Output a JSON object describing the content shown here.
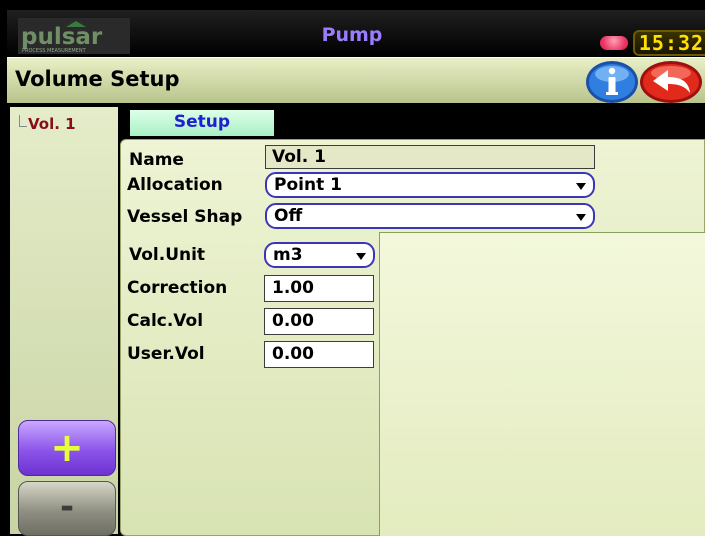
{
  "topbar": {
    "logo_text": "pulsar",
    "logo_tagline": "PROCESS MEASUREMENT",
    "app_title": "Pump",
    "clock": "15:32",
    "colors": {
      "title": "#9a7cff",
      "clock_text": "#ffe000",
      "led": "#e8305e"
    }
  },
  "header": {
    "title": "Volume Setup",
    "info_icon": "info-icon",
    "back_icon": "back-arrow-icon"
  },
  "sidebar": {
    "items": [
      {
        "label": "Vol. 1"
      }
    ],
    "add_label": "+",
    "remove_label": "-"
  },
  "tabs": [
    {
      "label": "Setup",
      "active": true
    }
  ],
  "form": {
    "name": {
      "label": "Name",
      "value": "Vol.  1"
    },
    "allocation": {
      "label": "Allocation",
      "value": "Point 1"
    },
    "vessel_shape": {
      "label": "Vessel Shap",
      "value": "Off"
    },
    "vol_unit": {
      "label": "Vol.Unit",
      "value": "m3"
    },
    "correction": {
      "label": "Correction",
      "value": "1.00"
    },
    "calc_vol": {
      "label": "Calc.Vol",
      "value": "0.00"
    },
    "user_vol": {
      "label": "User.Vol",
      "value": "0.00"
    }
  }
}
